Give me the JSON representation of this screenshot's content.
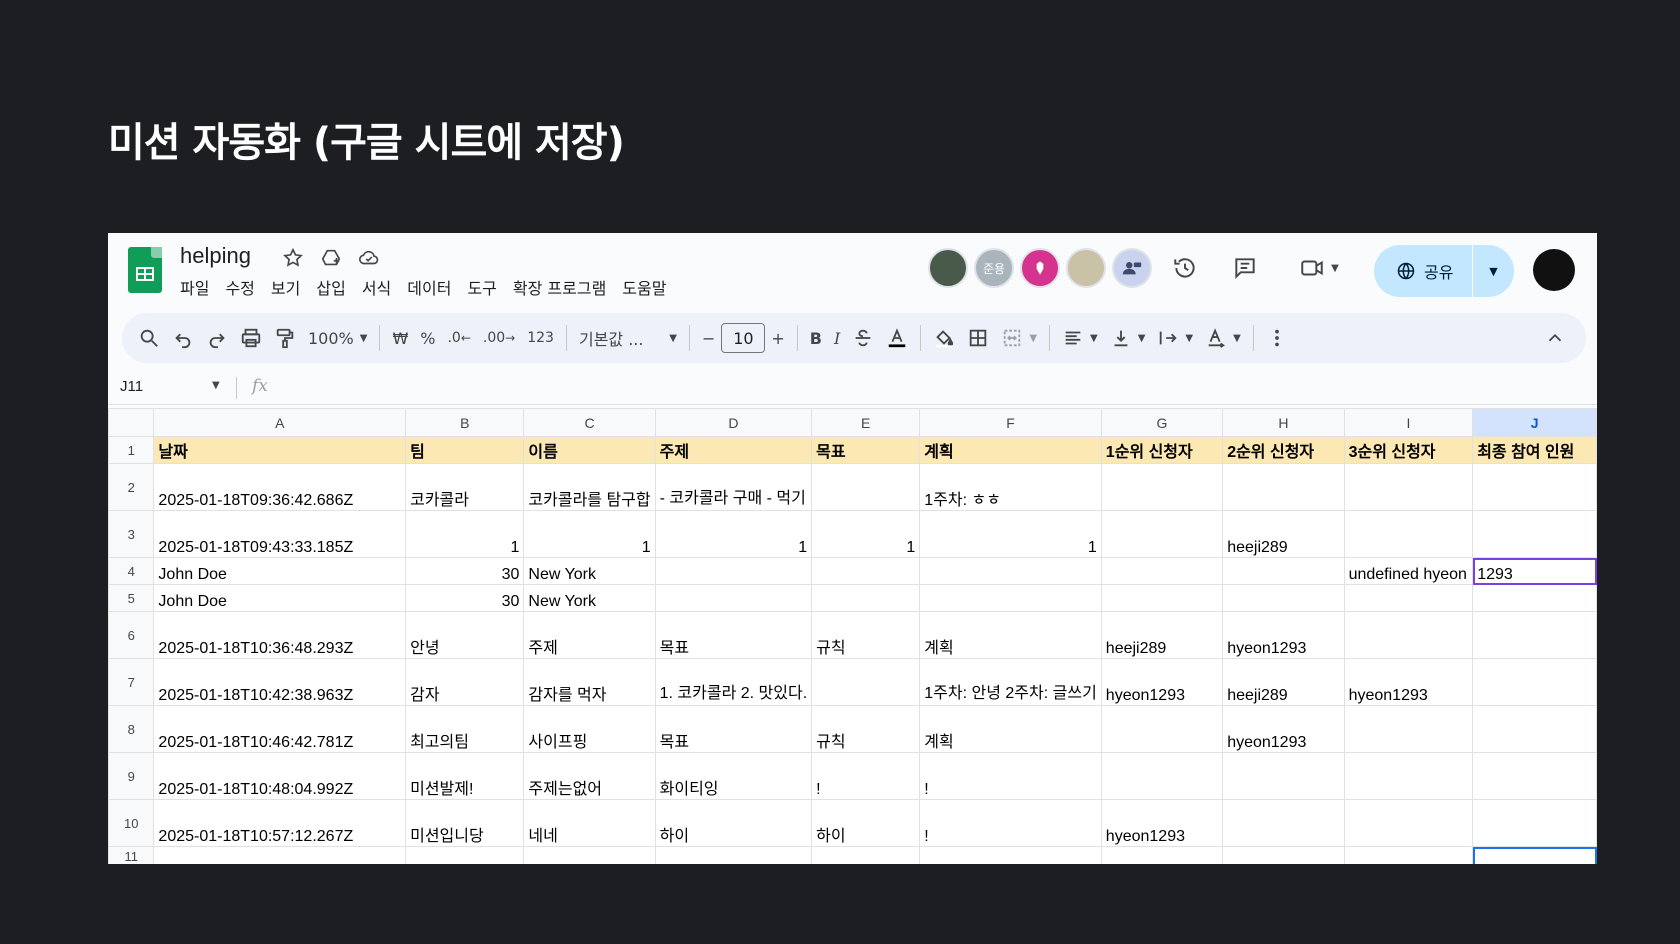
{
  "slide_title": "미션 자동화 (구글 시트에 저장)",
  "doc": {
    "title": "helping",
    "title_icons": [
      "star-icon",
      "move-to-drive-icon",
      "cloud-status-icon"
    ]
  },
  "menu": [
    "파일",
    "수정",
    "보기",
    "삽입",
    "서식",
    "데이터",
    "도구",
    "확장 프로그램",
    "도움말"
  ],
  "collaborators": [
    {
      "name": "collaborator-1",
      "label": "",
      "color": "#4a5a4a"
    },
    {
      "name": "collaborator-2",
      "label": "준용",
      "color": "#a9b4bd"
    },
    {
      "name": "collaborator-3",
      "label": "",
      "color": "#d6338f"
    },
    {
      "name": "collaborator-4",
      "label": "",
      "color": "#c9c2a6"
    },
    {
      "name": "collaborator-5",
      "label": "",
      "color": "#c9d3f0"
    }
  ],
  "share": {
    "label": "공유"
  },
  "toolbar": {
    "zoom": "100%",
    "currency": "₩",
    "percent": "%",
    "decrease_decimal": ".0",
    "increase_decimal": ".00",
    "more_formats": "123",
    "font": "기본값 ...",
    "font_size": "10",
    "bold": "B",
    "italic": "I"
  },
  "formula_bar": {
    "name_box": "J11",
    "fx": "fx",
    "value": ""
  },
  "columns": [
    "A",
    "B",
    "C",
    "D",
    "E",
    "F",
    "G",
    "H",
    "I",
    "J"
  ],
  "selected_column": "J",
  "header_row": [
    "날짜",
    "팀",
    "이름",
    "주제",
    "목표",
    "계획",
    "1순위 신청자",
    "2순위 신청자",
    "3순위 신청자",
    "최종 참여 인원"
  ],
  "rows": [
    {
      "n": "2",
      "cells": [
        "2025-01-18T09:36:42.686Z",
        "코카콜라",
        "코카콜라를 탐구합",
        "- 코카콜라 구매\n- 먹기",
        "",
        "1주차: ㅎㅎ",
        "",
        "",
        "",
        ""
      ]
    },
    {
      "n": "3",
      "cells": [
        "2025-01-18T09:43:33.185Z",
        "1",
        "1",
        "1",
        "1",
        "1",
        "",
        "heeji289",
        "",
        ""
      ]
    },
    {
      "n": "4",
      "cells": [
        "John Doe",
        "30",
        "New York",
        "",
        "",
        "",
        "",
        "",
        "undefined hyeon",
        "1293"
      ]
    },
    {
      "n": "5",
      "cells": [
        "John Doe",
        "30",
        "New York",
        "",
        "",
        "",
        "",
        "",
        "",
        ""
      ]
    },
    {
      "n": "6",
      "cells": [
        "2025-01-18T10:36:48.293Z",
        "안녕",
        "주제",
        "목표",
        "규칙",
        "계획",
        "heeji289",
        "hyeon1293",
        "",
        ""
      ]
    },
    {
      "n": "7",
      "cells": [
        "2025-01-18T10:42:38.963Z",
        "감자",
        "감자를 먹자",
        "1. 코카콜라\n2. 맛있다.",
        "",
        "1주차: 안녕\n2주차: 글쓰기",
        "hyeon1293",
        "heeji289",
        "hyeon1293",
        ""
      ]
    },
    {
      "n": "8",
      "cells": [
        "2025-01-18T10:46:42.781Z",
        "최고의팀",
        "사이프핑",
        "목표",
        "규칙",
        "계획",
        "",
        "hyeon1293",
        "",
        ""
      ]
    },
    {
      "n": "9",
      "cells": [
        "2025-01-18T10:48:04.992Z",
        "미션발제!",
        "주제는없어",
        "화이티잉",
        "!",
        "!",
        "",
        "",
        "",
        ""
      ]
    },
    {
      "n": "10",
      "cells": [
        "2025-01-18T10:57:12.267Z",
        "미션입니당",
        "네네",
        "하이",
        "하이",
        "!",
        "hyeon1293",
        "",
        "",
        ""
      ]
    },
    {
      "n": "11",
      "cells": [
        "",
        "",
        "",
        "",
        "",
        "",
        "",
        "",
        "",
        ""
      ]
    }
  ]
}
